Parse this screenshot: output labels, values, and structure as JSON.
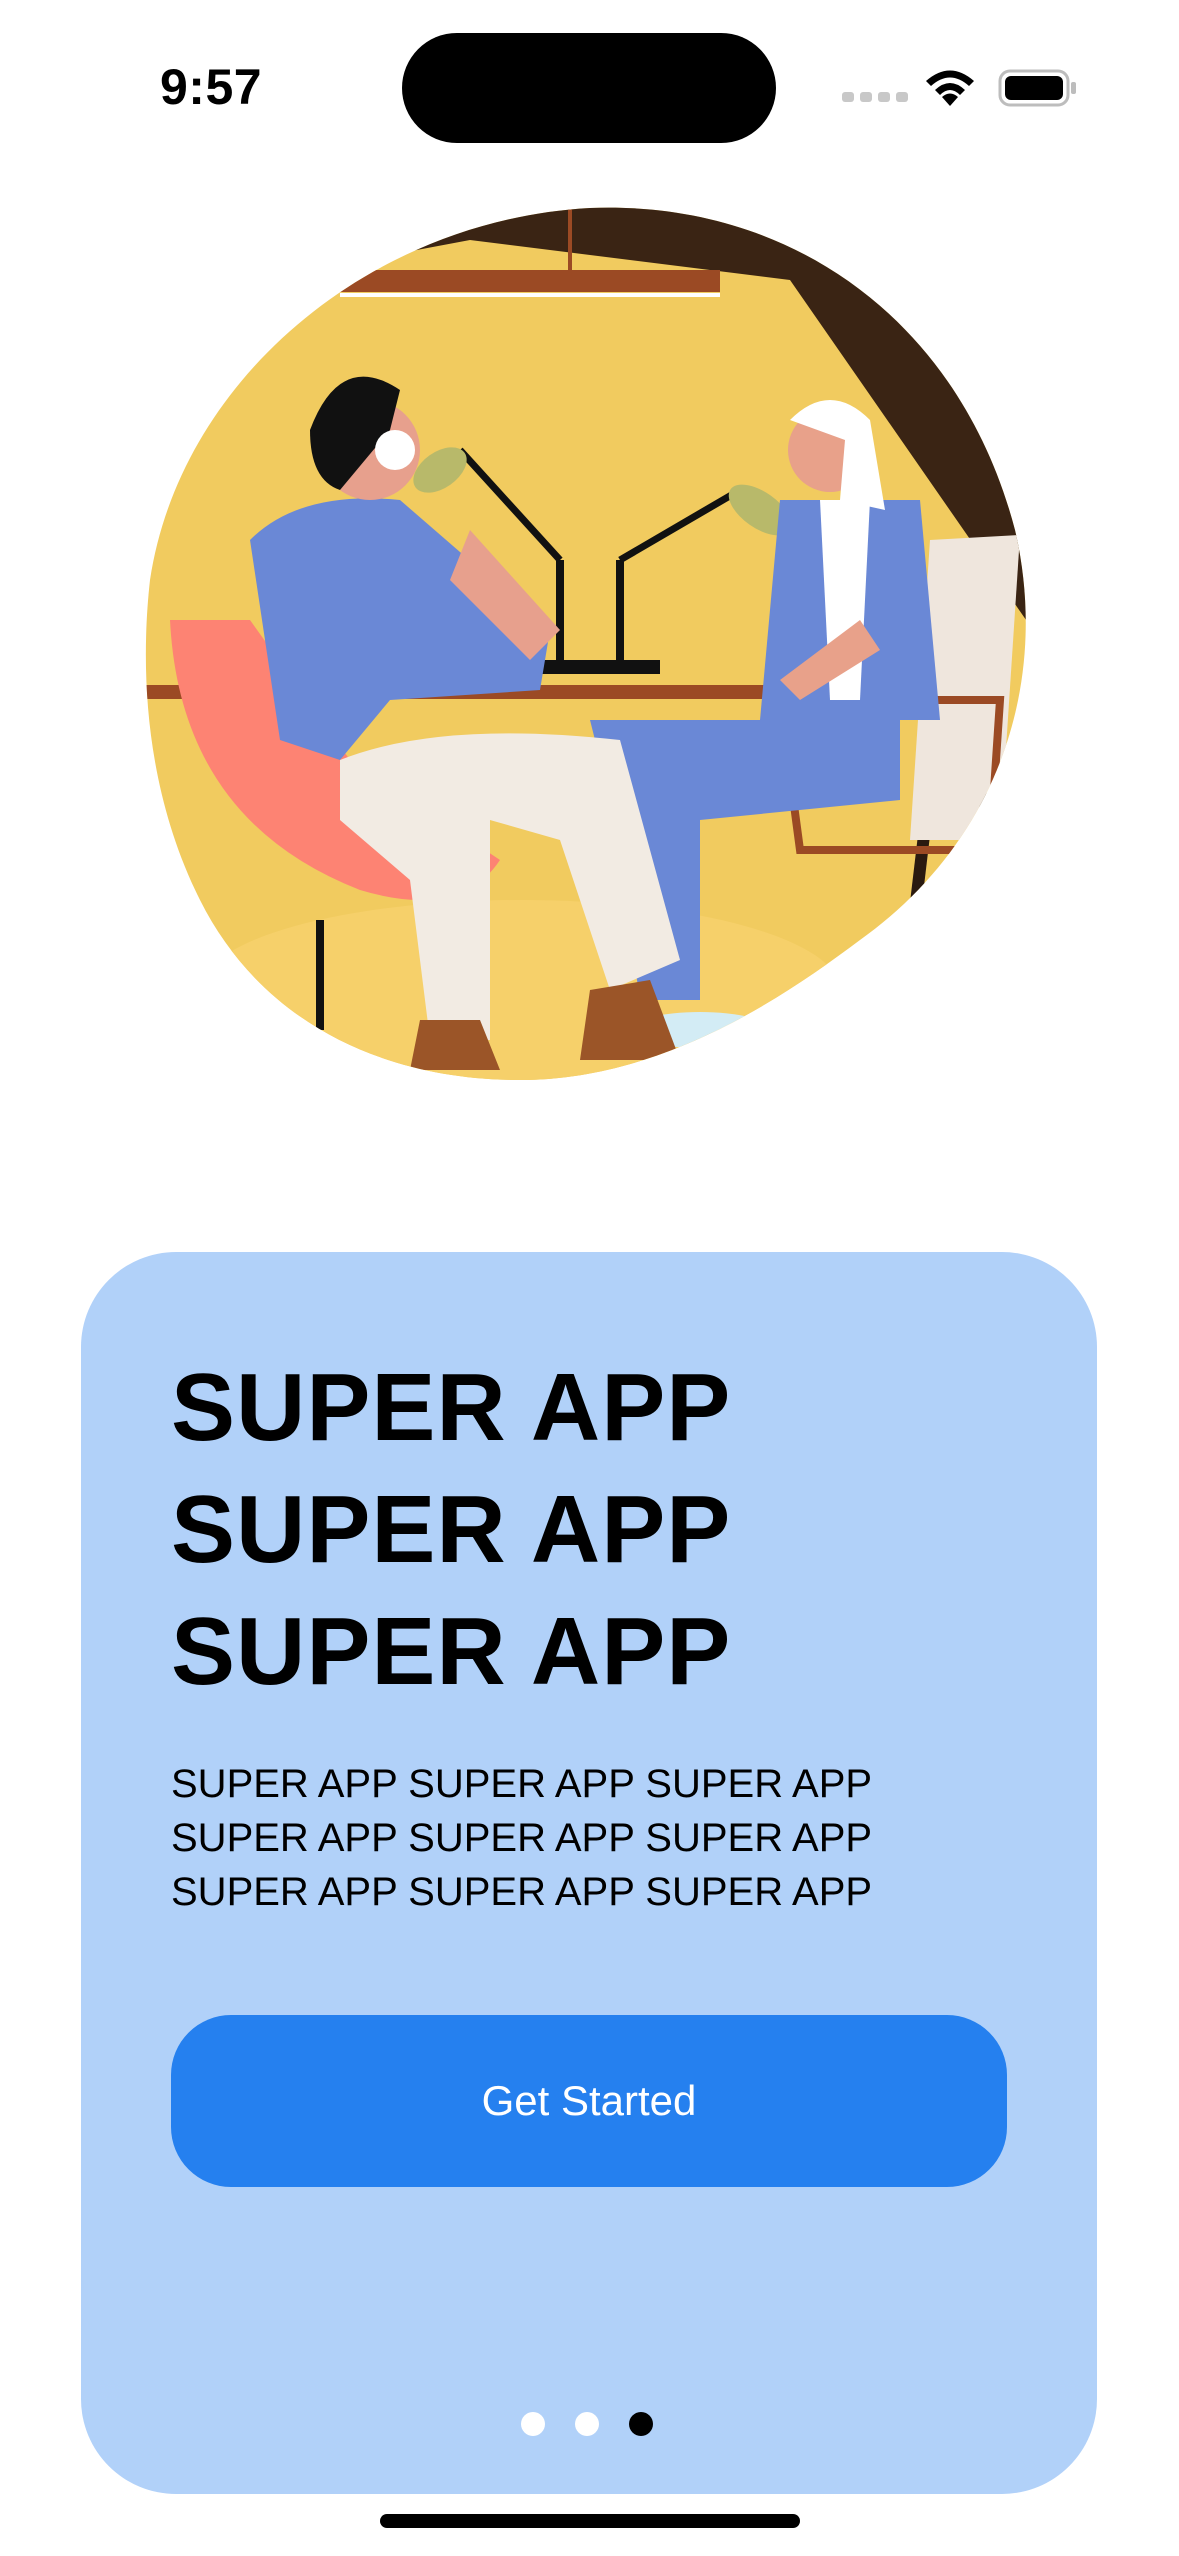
{
  "status_bar": {
    "time": "9:57"
  },
  "hero": {
    "illustration": "two-people-podcast-illustration",
    "colors": {
      "backdrop_yellow": "#f1cb5f",
      "backdrop_dark": "#3a2414",
      "shirt_blue": "#6a88d6",
      "chair_coral": "#fd8373",
      "pants_cream": "#f2ebe3",
      "shoe_brown": "#9b5528"
    }
  },
  "card": {
    "background": "#b1d1f9",
    "headline_lines": [
      "SUPER APP",
      "SUPER APP",
      "SUPER APP"
    ],
    "body_lines": [
      "SUPER APP SUPER APP SUPER APP",
      "SUPER APP SUPER APP SUPER APP",
      "SUPER APP SUPER APP SUPER APP"
    ],
    "cta_label": "Get Started",
    "cta_color": "#2580ef",
    "page_indicator": {
      "total": 3,
      "active_index": 3
    }
  }
}
